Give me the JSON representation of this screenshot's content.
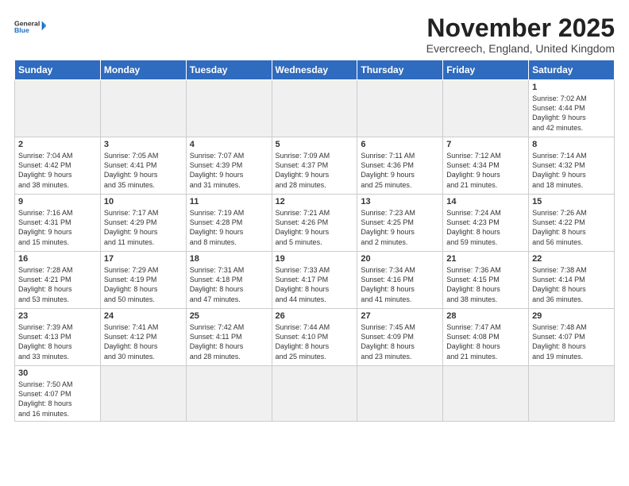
{
  "header": {
    "logo_general": "General",
    "logo_blue": "Blue",
    "month_title": "November 2025",
    "subtitle": "Evercreech, England, United Kingdom"
  },
  "weekdays": [
    "Sunday",
    "Monday",
    "Tuesday",
    "Wednesday",
    "Thursday",
    "Friday",
    "Saturday"
  ],
  "rows": [
    [
      {
        "day": "",
        "info": ""
      },
      {
        "day": "",
        "info": ""
      },
      {
        "day": "",
        "info": ""
      },
      {
        "day": "",
        "info": ""
      },
      {
        "day": "",
        "info": ""
      },
      {
        "day": "",
        "info": ""
      },
      {
        "day": "1",
        "info": "Sunrise: 7:02 AM\nSunset: 4:44 PM\nDaylight: 9 hours\nand 42 minutes."
      }
    ],
    [
      {
        "day": "2",
        "info": "Sunrise: 7:04 AM\nSunset: 4:42 PM\nDaylight: 9 hours\nand 38 minutes."
      },
      {
        "day": "3",
        "info": "Sunrise: 7:05 AM\nSunset: 4:41 PM\nDaylight: 9 hours\nand 35 minutes."
      },
      {
        "day": "4",
        "info": "Sunrise: 7:07 AM\nSunset: 4:39 PM\nDaylight: 9 hours\nand 31 minutes."
      },
      {
        "day": "5",
        "info": "Sunrise: 7:09 AM\nSunset: 4:37 PM\nDaylight: 9 hours\nand 28 minutes."
      },
      {
        "day": "6",
        "info": "Sunrise: 7:11 AM\nSunset: 4:36 PM\nDaylight: 9 hours\nand 25 minutes."
      },
      {
        "day": "7",
        "info": "Sunrise: 7:12 AM\nSunset: 4:34 PM\nDaylight: 9 hours\nand 21 minutes."
      },
      {
        "day": "8",
        "info": "Sunrise: 7:14 AM\nSunset: 4:32 PM\nDaylight: 9 hours\nand 18 minutes."
      }
    ],
    [
      {
        "day": "9",
        "info": "Sunrise: 7:16 AM\nSunset: 4:31 PM\nDaylight: 9 hours\nand 15 minutes."
      },
      {
        "day": "10",
        "info": "Sunrise: 7:17 AM\nSunset: 4:29 PM\nDaylight: 9 hours\nand 11 minutes."
      },
      {
        "day": "11",
        "info": "Sunrise: 7:19 AM\nSunset: 4:28 PM\nDaylight: 9 hours\nand 8 minutes."
      },
      {
        "day": "12",
        "info": "Sunrise: 7:21 AM\nSunset: 4:26 PM\nDaylight: 9 hours\nand 5 minutes."
      },
      {
        "day": "13",
        "info": "Sunrise: 7:23 AM\nSunset: 4:25 PM\nDaylight: 9 hours\nand 2 minutes."
      },
      {
        "day": "14",
        "info": "Sunrise: 7:24 AM\nSunset: 4:23 PM\nDaylight: 8 hours\nand 59 minutes."
      },
      {
        "day": "15",
        "info": "Sunrise: 7:26 AM\nSunset: 4:22 PM\nDaylight: 8 hours\nand 56 minutes."
      }
    ],
    [
      {
        "day": "16",
        "info": "Sunrise: 7:28 AM\nSunset: 4:21 PM\nDaylight: 8 hours\nand 53 minutes."
      },
      {
        "day": "17",
        "info": "Sunrise: 7:29 AM\nSunset: 4:19 PM\nDaylight: 8 hours\nand 50 minutes."
      },
      {
        "day": "18",
        "info": "Sunrise: 7:31 AM\nSunset: 4:18 PM\nDaylight: 8 hours\nand 47 minutes."
      },
      {
        "day": "19",
        "info": "Sunrise: 7:33 AM\nSunset: 4:17 PM\nDaylight: 8 hours\nand 44 minutes."
      },
      {
        "day": "20",
        "info": "Sunrise: 7:34 AM\nSunset: 4:16 PM\nDaylight: 8 hours\nand 41 minutes."
      },
      {
        "day": "21",
        "info": "Sunrise: 7:36 AM\nSunset: 4:15 PM\nDaylight: 8 hours\nand 38 minutes."
      },
      {
        "day": "22",
        "info": "Sunrise: 7:38 AM\nSunset: 4:14 PM\nDaylight: 8 hours\nand 36 minutes."
      }
    ],
    [
      {
        "day": "23",
        "info": "Sunrise: 7:39 AM\nSunset: 4:13 PM\nDaylight: 8 hours\nand 33 minutes."
      },
      {
        "day": "24",
        "info": "Sunrise: 7:41 AM\nSunset: 4:12 PM\nDaylight: 8 hours\nand 30 minutes."
      },
      {
        "day": "25",
        "info": "Sunrise: 7:42 AM\nSunset: 4:11 PM\nDaylight: 8 hours\nand 28 minutes."
      },
      {
        "day": "26",
        "info": "Sunrise: 7:44 AM\nSunset: 4:10 PM\nDaylight: 8 hours\nand 25 minutes."
      },
      {
        "day": "27",
        "info": "Sunrise: 7:45 AM\nSunset: 4:09 PM\nDaylight: 8 hours\nand 23 minutes."
      },
      {
        "day": "28",
        "info": "Sunrise: 7:47 AM\nSunset: 4:08 PM\nDaylight: 8 hours\nand 21 minutes."
      },
      {
        "day": "29",
        "info": "Sunrise: 7:48 AM\nSunset: 4:07 PM\nDaylight: 8 hours\nand 19 minutes."
      }
    ],
    [
      {
        "day": "30",
        "info": "Sunrise: 7:50 AM\nSunset: 4:07 PM\nDaylight: 8 hours\nand 16 minutes."
      },
      {
        "day": "",
        "info": ""
      },
      {
        "day": "",
        "info": ""
      },
      {
        "day": "",
        "info": ""
      },
      {
        "day": "",
        "info": ""
      },
      {
        "day": "",
        "info": ""
      },
      {
        "day": "",
        "info": ""
      }
    ]
  ]
}
